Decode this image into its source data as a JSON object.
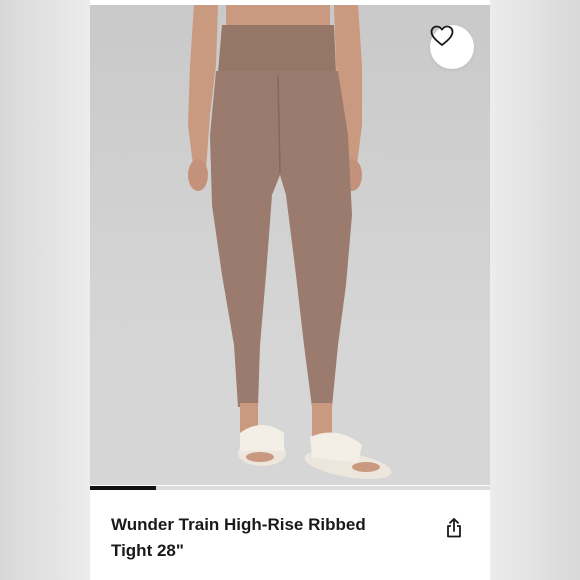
{
  "product": {
    "title": "Wunder Train High-Rise Ribbed Tight 28\"",
    "image_alt": "Woman wearing brown high-rise ribbed leggings with white slide sandals"
  },
  "gallery": {
    "progress_fraction": 0.165
  },
  "icons": {
    "favorite": "heart-outline-icon",
    "share": "share-icon"
  },
  "colors": {
    "legging": "#9a7b6d",
    "text": "#1a1a1a",
    "progress": "#111111"
  }
}
